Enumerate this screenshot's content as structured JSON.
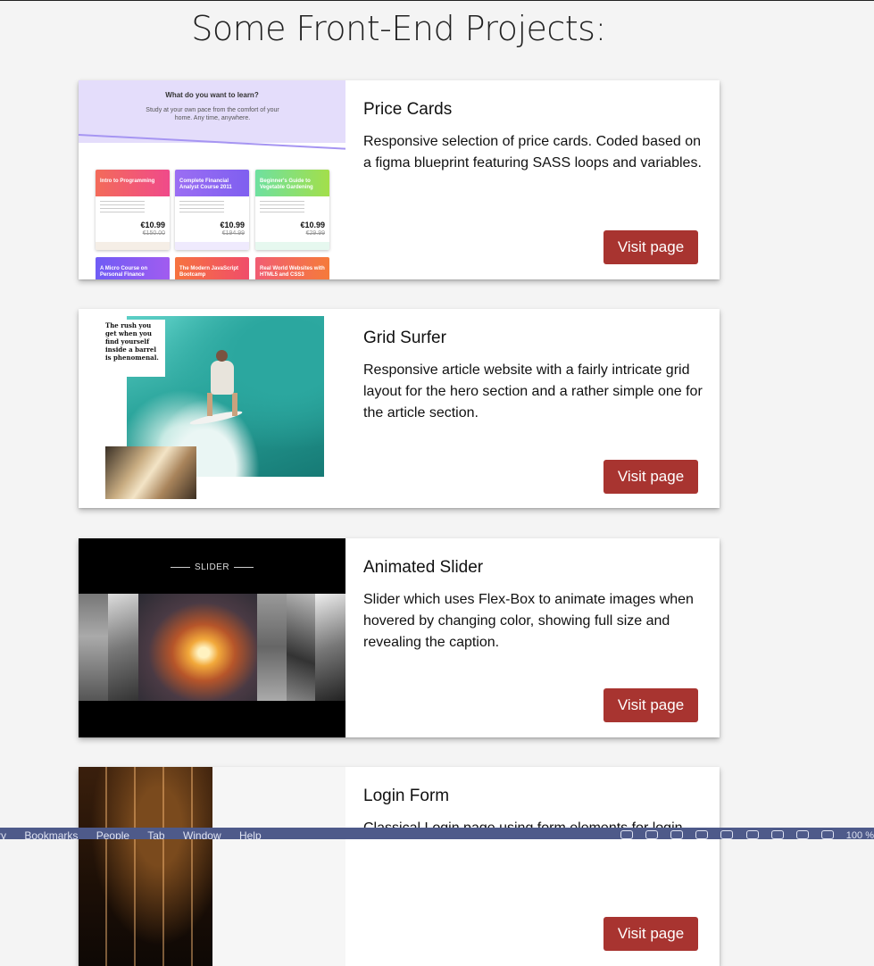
{
  "page": {
    "title": "Some Front-End Projects:"
  },
  "projects": [
    {
      "title": "Price Cards",
      "description": "Responsive selection of price cards. Coded based on a figma blueprint featuring SASS loops and variables.",
      "button": "Visit page",
      "preview": {
        "heading": "What do you want to learn?",
        "subheading": "Study at your own pace from the comfort of your home. Any time, anywhere.",
        "cards": [
          {
            "title": "Intro to Programming",
            "price": "€10.99",
            "old_price": "€150.00",
            "color": "#f06b5c"
          },
          {
            "title": "Complete Financial Analyst Course 2011",
            "price": "€10.99",
            "old_price": "€194.99",
            "color": "#9b6ef3"
          },
          {
            "title": "Beginner's Guide to Vegetable Gardening",
            "price": "€10.99",
            "old_price": "€29.99",
            "color": "#5fd39a"
          }
        ],
        "cards_row2": [
          {
            "title": "A Micro Course on Personal Finance",
            "color": "#6f5cf5"
          },
          {
            "title": "The Modern JavaScript Bootcamp",
            "color": "#f6733f"
          },
          {
            "title": "Real World Websites with HTML5 and CSS3",
            "color": "#f15d73"
          }
        ]
      }
    },
    {
      "title": "Grid Surfer",
      "description": "Responsive article website with a fairly intricate grid layout for the hero section and a rather simple one for the article section.",
      "button": "Visit page",
      "preview": {
        "quote": "The rush you get when you find yourself inside a barrel is phenomenal."
      }
    },
    {
      "title": "Animated Slider",
      "description": "Slider which uses Flex-Box to animate images when hovered by changing color, showing full size and revealing the caption.",
      "button": "Visit page",
      "preview": {
        "heading": "SLIDER"
      }
    },
    {
      "title": "Login Form",
      "description": "Classical Login page using form elements for login",
      "button": "Visit page"
    }
  ],
  "menubar": {
    "items": [
      "tory",
      "Bookmarks",
      "People",
      "Tab",
      "Window",
      "Help"
    ],
    "battery": "100 %"
  }
}
